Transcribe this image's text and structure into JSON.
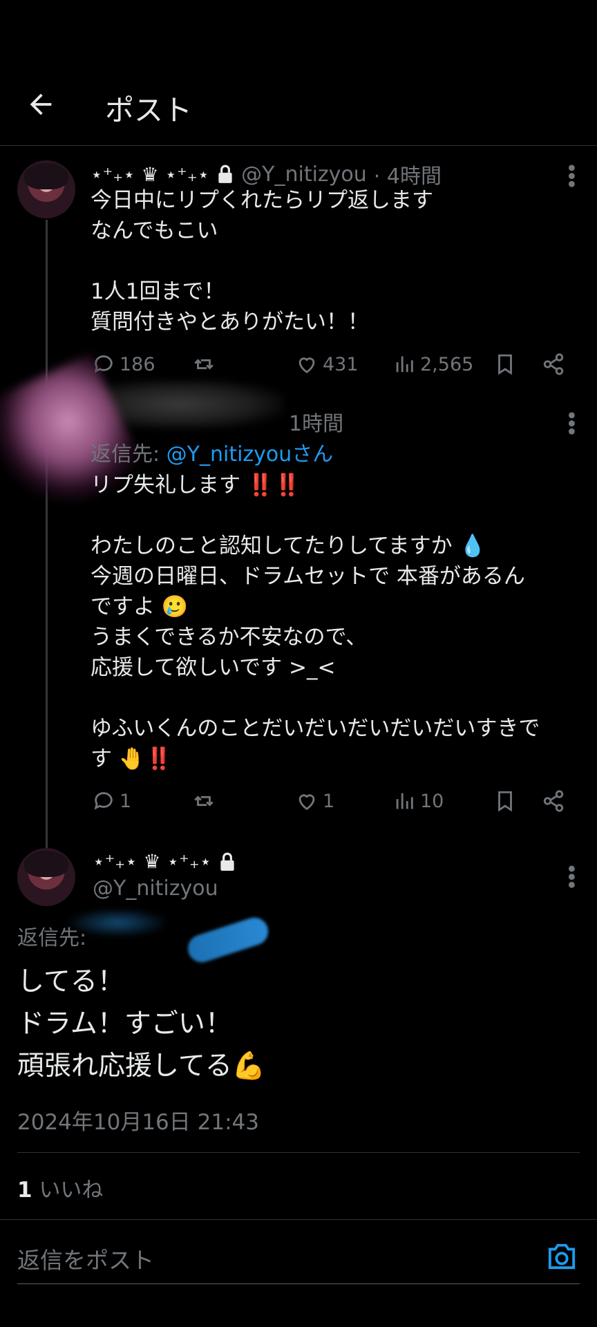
{
  "header": {
    "title": "ポスト"
  },
  "post1": {
    "name": "⋆⁺₊⋆ ♛ ⋆⁺₊⋆",
    "handle": "@Y_nitizyou",
    "time": "· 4時間",
    "body": "今日中にリプくれたらリプ返します\nなんでもこい\n\n1人1回まで！\n質問付きやとありがたい！！",
    "replies": "186",
    "likes": "431",
    "views": "2,565"
  },
  "post2": {
    "time": "1時間",
    "reply_to_label": "返信先: ",
    "reply_to_handle": "@Y_nitizyou",
    "reply_to_suffix": "さん",
    "body_line1": "リプ失礼します ‼️‼️",
    "body_rest": "わたしのこと認知してたりしてますか 💧\n今週の日曜日、ドラムセットで 本番があるん\nですよ 🥲\nうまくできるか不安なので、\n応援して欲しいです >_< \n\nゆふいくんのことだいだいだいだいだいすきで\nす 🤚‼️",
    "replies": "1",
    "likes": "1",
    "views": "10"
  },
  "post3": {
    "name": "⋆⁺₊⋆ ♛ ⋆⁺₊⋆",
    "handle": "@Y_nitizyou",
    "reply_to_label": "返信先:",
    "body": "してる！\nドラム！すごい！\n頑張れ応援してる💪",
    "timestamp": "2024年10月16日 21:43",
    "like_count": "1",
    "like_label": "いいね"
  },
  "composer": {
    "placeholder": "返信をポスト"
  },
  "colors": {
    "accent": "#1d9bf0",
    "muted": "#71767b",
    "text": "#e7e9ea",
    "background": "#000000"
  },
  "icons": [
    "back-arrow-icon",
    "lock-icon",
    "more-icon",
    "reply-icon",
    "repost-icon",
    "like-icon",
    "views-icon",
    "bookmark-icon",
    "share-icon",
    "camera-icon"
  ]
}
